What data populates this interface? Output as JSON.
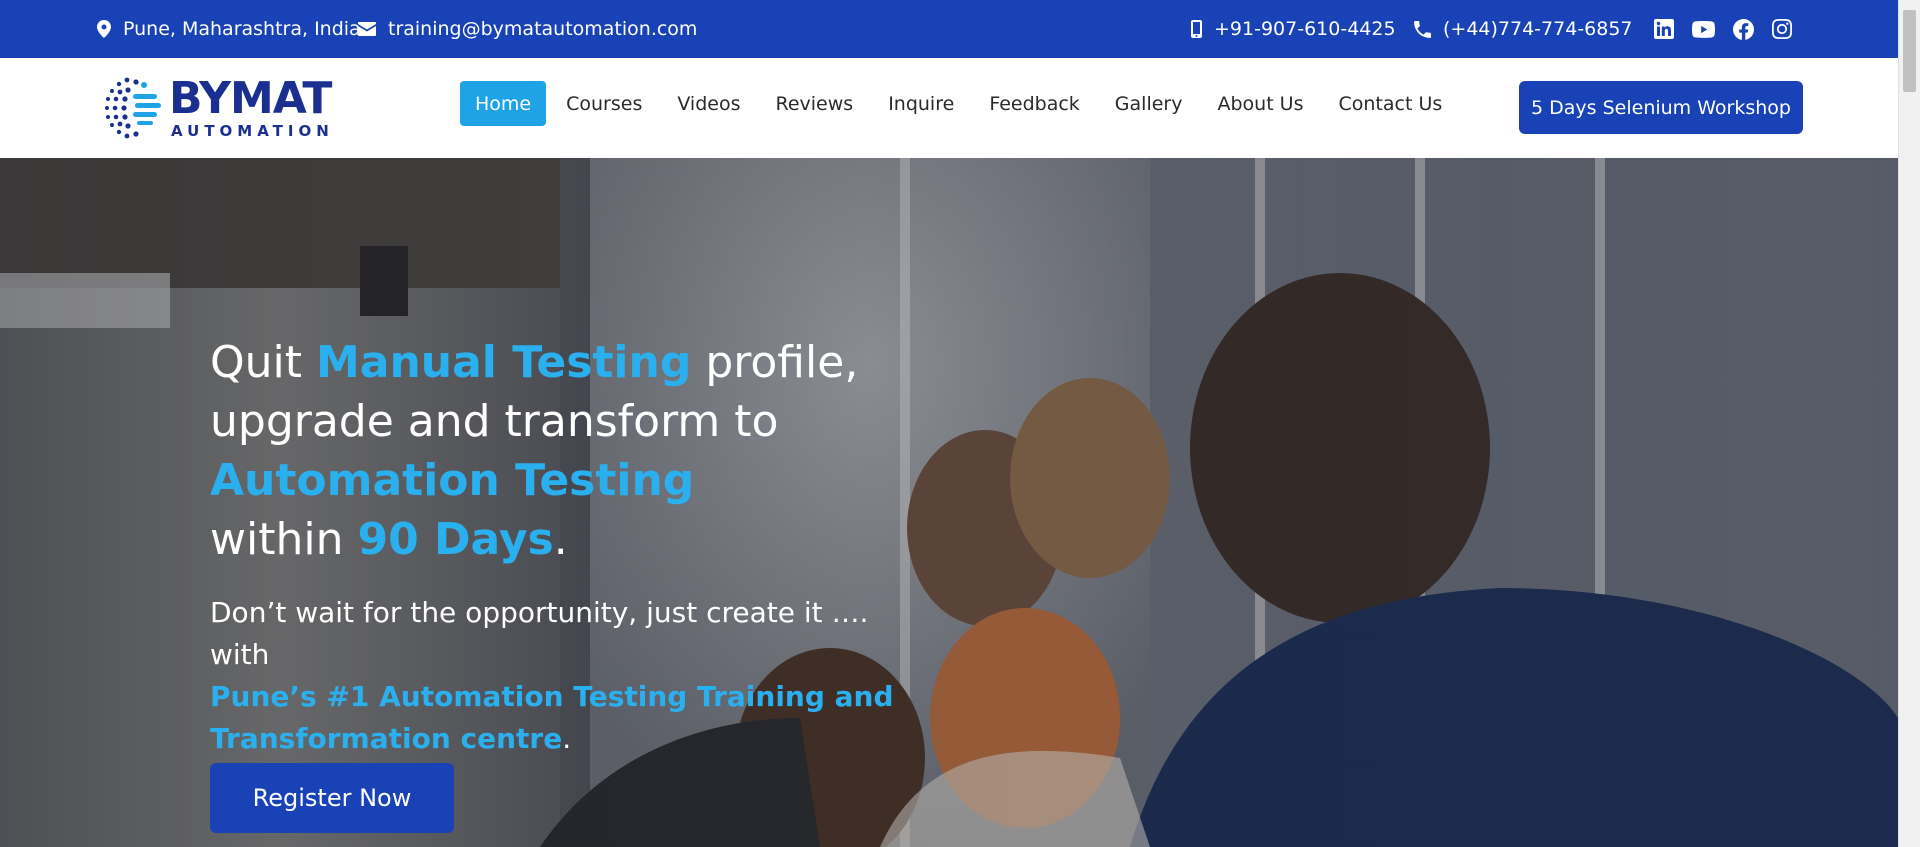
{
  "topbar": {
    "location": "Pune, Maharashtra, India",
    "email": "training@bymatautomation.com",
    "mobile": "+91-907-610-4425",
    "phone": "(+44)774-774-6857",
    "social_icons": [
      "linkedin-icon",
      "youtube-icon",
      "facebook-icon",
      "instagram-icon"
    ]
  },
  "logo": {
    "main": "BYMAT",
    "sub": "AUTOMATION"
  },
  "nav": {
    "items": [
      "Home",
      "Courses",
      "Videos",
      "Reviews",
      "Inquire",
      "Feedback",
      "Gallery",
      "About Us",
      "Contact Us"
    ],
    "active": "Home",
    "cta": "5 Days Selenium Workshop"
  },
  "hero": {
    "line1_a": "Quit ",
    "line1_hl": "Manual Testing",
    "line1_b": " profile,",
    "line2": "upgrade and transform to",
    "line3_hl": "Automation Testing",
    "line4_a": "within ",
    "line4_hl": "90 Days",
    "line4_b": ".",
    "sub_a": "Don’t wait for the opportunity, just create it …. with",
    "sub_hl": "Pune’s #1 Automation Testing Training and Transformation centre",
    "sub_b": ".",
    "register_label": "Register Now"
  },
  "colors": {
    "brand_blue": "#1842b6",
    "accent_cyan": "#1ea3e6",
    "highlight_text": "#2bb0ef"
  }
}
